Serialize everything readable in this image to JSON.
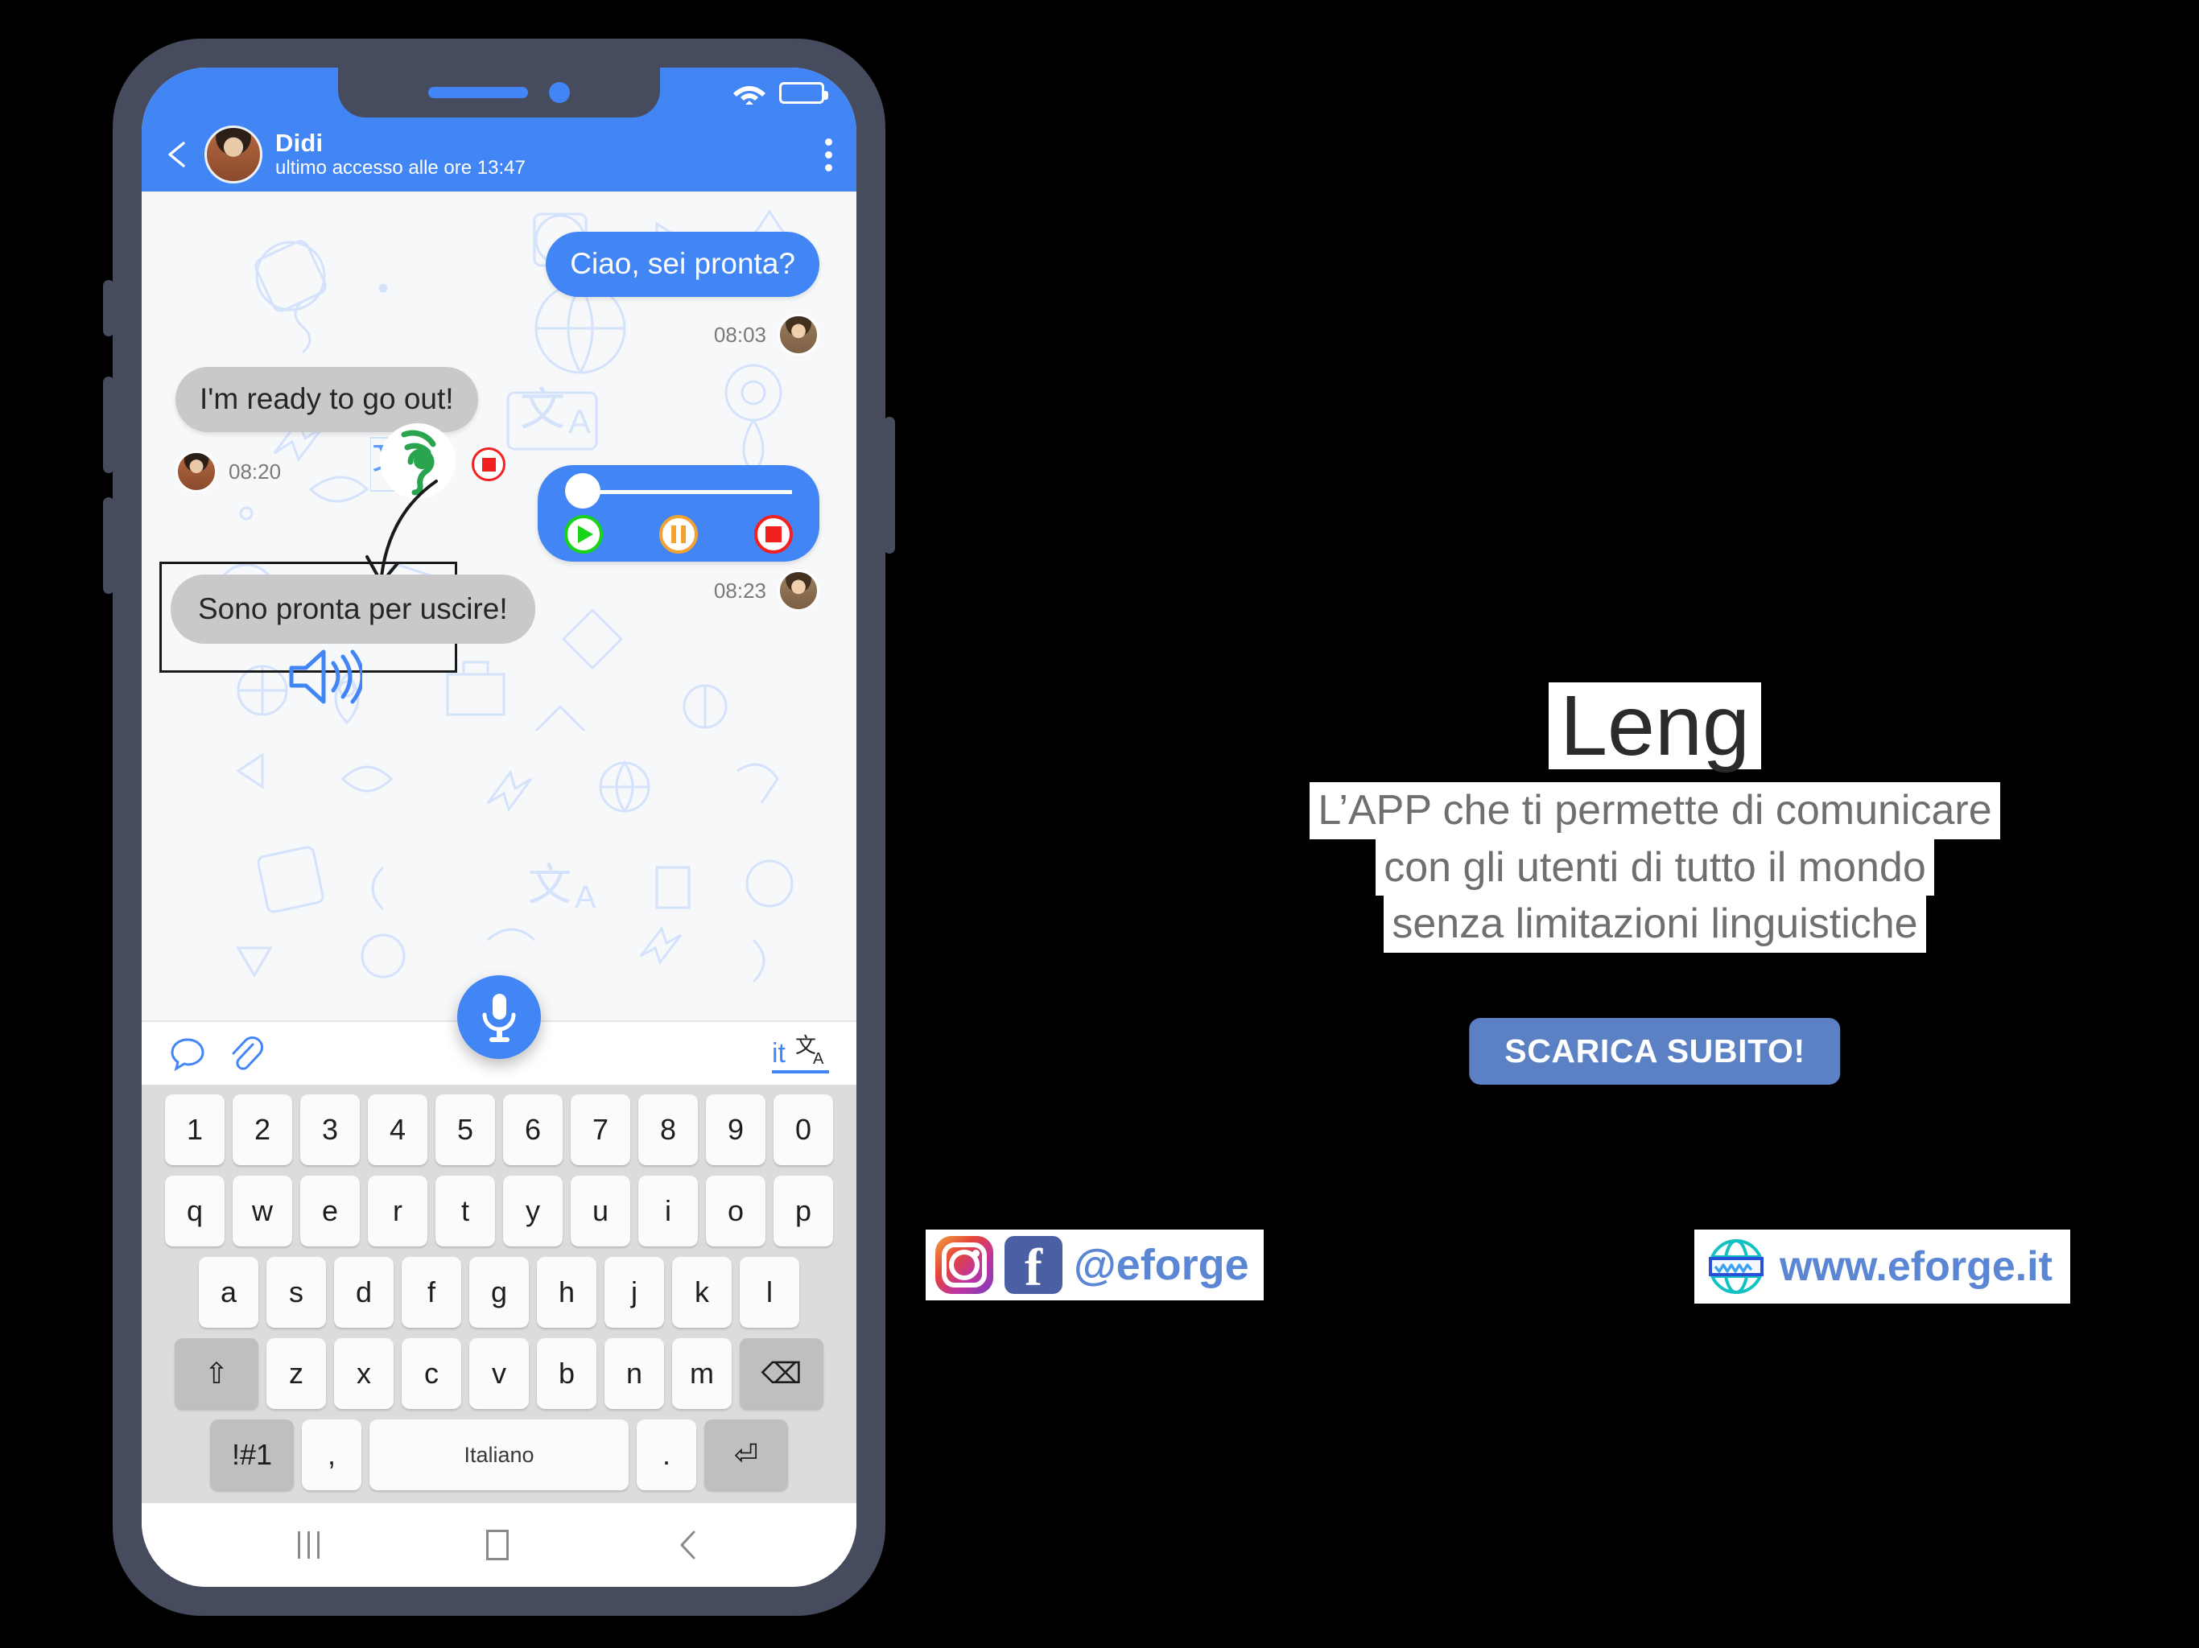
{
  "phone": {
    "statusbar": {
      "wifi_icon": "wifi-icon",
      "battery_icon": "battery-icon"
    },
    "header": {
      "back_icon": "back-arrow-icon",
      "avatar": "contact-avatar",
      "name": "Didi",
      "status": "ultimo accesso alle ore 13:47",
      "menu_icon": "kebab-menu-icon"
    },
    "messages": [
      {
        "id": "m1",
        "side": "out",
        "text": "Ciao, sei pronta?",
        "time": "08:03"
      },
      {
        "id": "m2",
        "side": "in",
        "text": "I'm ready to go out!",
        "time": "08:20"
      },
      {
        "id": "m3",
        "side": "out",
        "type": "audio",
        "time": "08:23"
      },
      {
        "id": "m4",
        "side": "in",
        "type": "translated",
        "text": "Sono pronta per uscire!"
      }
    ],
    "audio_player": {
      "progress": 0,
      "play_label": "play-button",
      "pause_label": "pause-button",
      "stop_label": "stop-button"
    },
    "overlay": {
      "listen_icon": "ear-listening-icon",
      "stop_recording_icon": "stop-recording-icon",
      "translate_icon": "translate-icon",
      "arrow_icon": "curved-arrow-icon",
      "speaker_icon": "speaker-output-icon"
    },
    "input_bar": {
      "chat_icon": "chat-bubble-icon",
      "attach_icon": "paperclip-icon",
      "mic_icon": "microphone-icon",
      "language_code": "it",
      "translate_icon": "translate-icon"
    },
    "keyboard": {
      "row_numbers": [
        "1",
        "2",
        "3",
        "4",
        "5",
        "6",
        "7",
        "8",
        "9",
        "0"
      ],
      "row_top": [
        "q",
        "w",
        "e",
        "r",
        "t",
        "y",
        "u",
        "i",
        "o",
        "p"
      ],
      "row_mid": [
        "a",
        "s",
        "d",
        "f",
        "g",
        "h",
        "j",
        "k",
        "l"
      ],
      "row_low": [
        "z",
        "x",
        "c",
        "v",
        "b",
        "n",
        "m"
      ],
      "shift_label": "⇧",
      "backspace_label": "⌫",
      "symbols_label": "!#1",
      "comma_label": ",",
      "space_label": "Italiano",
      "dot_label": ".",
      "enter_label": "⏎"
    },
    "navbar": {
      "recents_icon": "recents-icon",
      "home_icon": "home-icon",
      "back_icon": "back-icon"
    }
  },
  "brand": {
    "logo_icon": "leng-logo-icon",
    "name": "Leng",
    "tagline_line1": "L’APP che ti permette di comunicare",
    "tagline_line2": "con gli utenti di tutto il mondo",
    "tagline_line3": "senza limitazioni linguistiche",
    "cta_label": "SCARICA SUBITO!",
    "social_handle": "@eforge",
    "website": "www.eforge.it",
    "instagram_icon": "instagram-icon",
    "facebook_icon": "facebook-icon",
    "globe_icon": "globe-icon",
    "colors": {
      "accent_blue": "#4285f4",
      "brand_blue": "#5b81c4",
      "link_blue": "#5b86d4",
      "phone_frame": "#464b5e",
      "bubble_in": "#c9c9c9"
    }
  }
}
